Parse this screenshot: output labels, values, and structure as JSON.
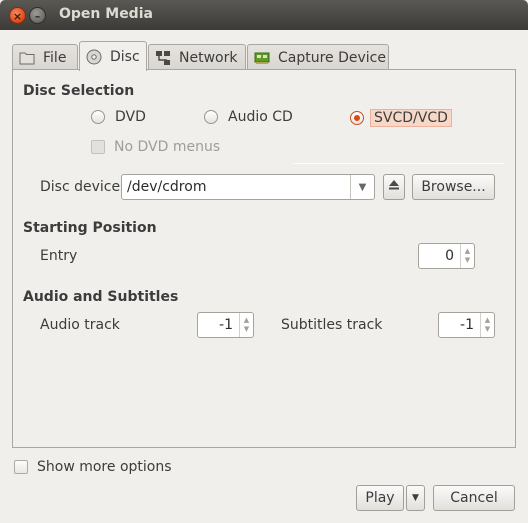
{
  "window": {
    "title": "Open Media",
    "close_glyph": "×",
    "minimize_glyph": "–"
  },
  "tabs": [
    {
      "label": "File",
      "icon": "folder-icon"
    },
    {
      "label": "Disc",
      "icon": "disc-icon"
    },
    {
      "label": "Network",
      "icon": "network-icon"
    },
    {
      "label": "Capture Device",
      "icon": "capture-card-icon"
    }
  ],
  "disc_selection": {
    "title": "Disc Selection",
    "options": [
      {
        "label": "DVD",
        "selected": false
      },
      {
        "label": "Audio CD",
        "selected": false
      },
      {
        "label": "SVCD/VCD",
        "selected": true
      }
    ],
    "no_menus_label": "No DVD menus",
    "no_menus_checked": false,
    "device_label": "Disc device",
    "device_value": "/dev/cdrom",
    "browse_label": "Browse..."
  },
  "starting_position": {
    "title": "Starting Position",
    "entry_label": "Entry",
    "entry_value": "0"
  },
  "audio_subtitles": {
    "title": "Audio and Subtitles",
    "audio_label": "Audio track",
    "audio_value": "-1",
    "subtitles_label": "Subtitles track",
    "subtitles_value": "-1"
  },
  "footer": {
    "more_options_label": "Show more options",
    "play_label": "Play",
    "cancel_label": "Cancel"
  },
  "colors": {
    "accent": "#dd4814",
    "background": "#f1efec",
    "titlebar": "#3c3b37"
  }
}
